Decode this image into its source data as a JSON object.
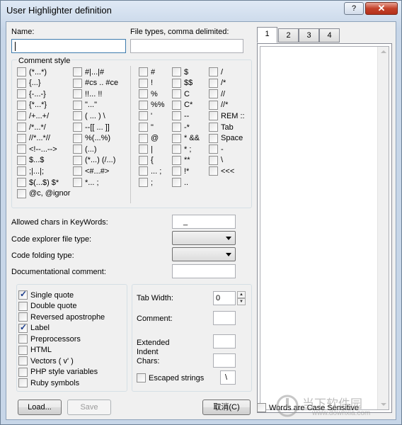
{
  "window": {
    "title": "User Highlighter definition",
    "help_label": "?",
    "close_label": "✕"
  },
  "name_label": "Name:",
  "file_types_label": "File types, comma delimited:",
  "comment_style": {
    "label": "Comment style",
    "col1": [
      "(*...*)",
      "{...}",
      "{-...-}",
      "{*...*}",
      "/+...+/",
      "/*...*/",
      "//*...*//",
      "<!--...-->",
      "$...$",
      ";|...|;",
      "$(...$)  $*",
      "@c, @ignor"
    ],
    "col2": [
      "#|...|#",
      "#cs .. #ce",
      "!!... !!",
      "\"...\"",
      "( ... )  \\",
      "--[[ ... ]]",
      "%(...%)",
      "(...)",
      "(*...)  (/...)",
      "<#...#>",
      "*... ;"
    ],
    "col3": [
      "#",
      "!",
      "%",
      "%%",
      "'",
      "\"",
      "@",
      "|",
      "{",
      "... ;",
      ";"
    ],
    "col4": [
      "$",
      "$$",
      "C",
      "C*",
      "--",
      "-*",
      "*  &&",
      "* ;",
      "**",
      "!*",
      ".."
    ],
    "col5": [
      "/",
      "/*",
      "//",
      "//*",
      "REM  ::",
      "Tab",
      "Space",
      "-",
      "\\",
      "<<<"
    ]
  },
  "allowed_chars": {
    "label": "Allowed chars in KeyWords:",
    "value": "_"
  },
  "code_explorer": {
    "label": "Code explorer file type:",
    "value": ""
  },
  "code_folding": {
    "label": "Code folding type:",
    "value": ""
  },
  "doc_comment": {
    "label": "Documentational comment:",
    "value": ""
  },
  "options": [
    {
      "label": "Single quote",
      "checked": true
    },
    {
      "label": "Double quote",
      "checked": false
    },
    {
      "label": "Reversed apostrophe",
      "checked": false
    },
    {
      "label": "Label",
      "checked": true
    },
    {
      "label": "Preprocessors",
      "checked": false
    },
    {
      "label": "HTML",
      "checked": false
    },
    {
      "label": "Vectors ( v' )",
      "checked": false
    },
    {
      "label": "PHP style variables",
      "checked": false
    },
    {
      "label": "Ruby symbols",
      "checked": false
    }
  ],
  "tab_width": {
    "label": "Tab Width:",
    "value": "0"
  },
  "comment": {
    "label": "Comment:",
    "value": ""
  },
  "extended_indent": {
    "label_line1": "Extended",
    "label_line2": "Indent",
    "label_line3": "Chars:",
    "value": ""
  },
  "escaped_strings": {
    "label": "Escaped strings",
    "value": "\\"
  },
  "tabs": [
    "1",
    "2",
    "3",
    "4"
  ],
  "case_sensitive_label": "Words are Case Sensitive",
  "buttons": {
    "load": "Load...",
    "save": "Save",
    "cancel": "取消(C)"
  },
  "watermark": {
    "brand": "当下软件园",
    "url": "www.downxia.com"
  }
}
